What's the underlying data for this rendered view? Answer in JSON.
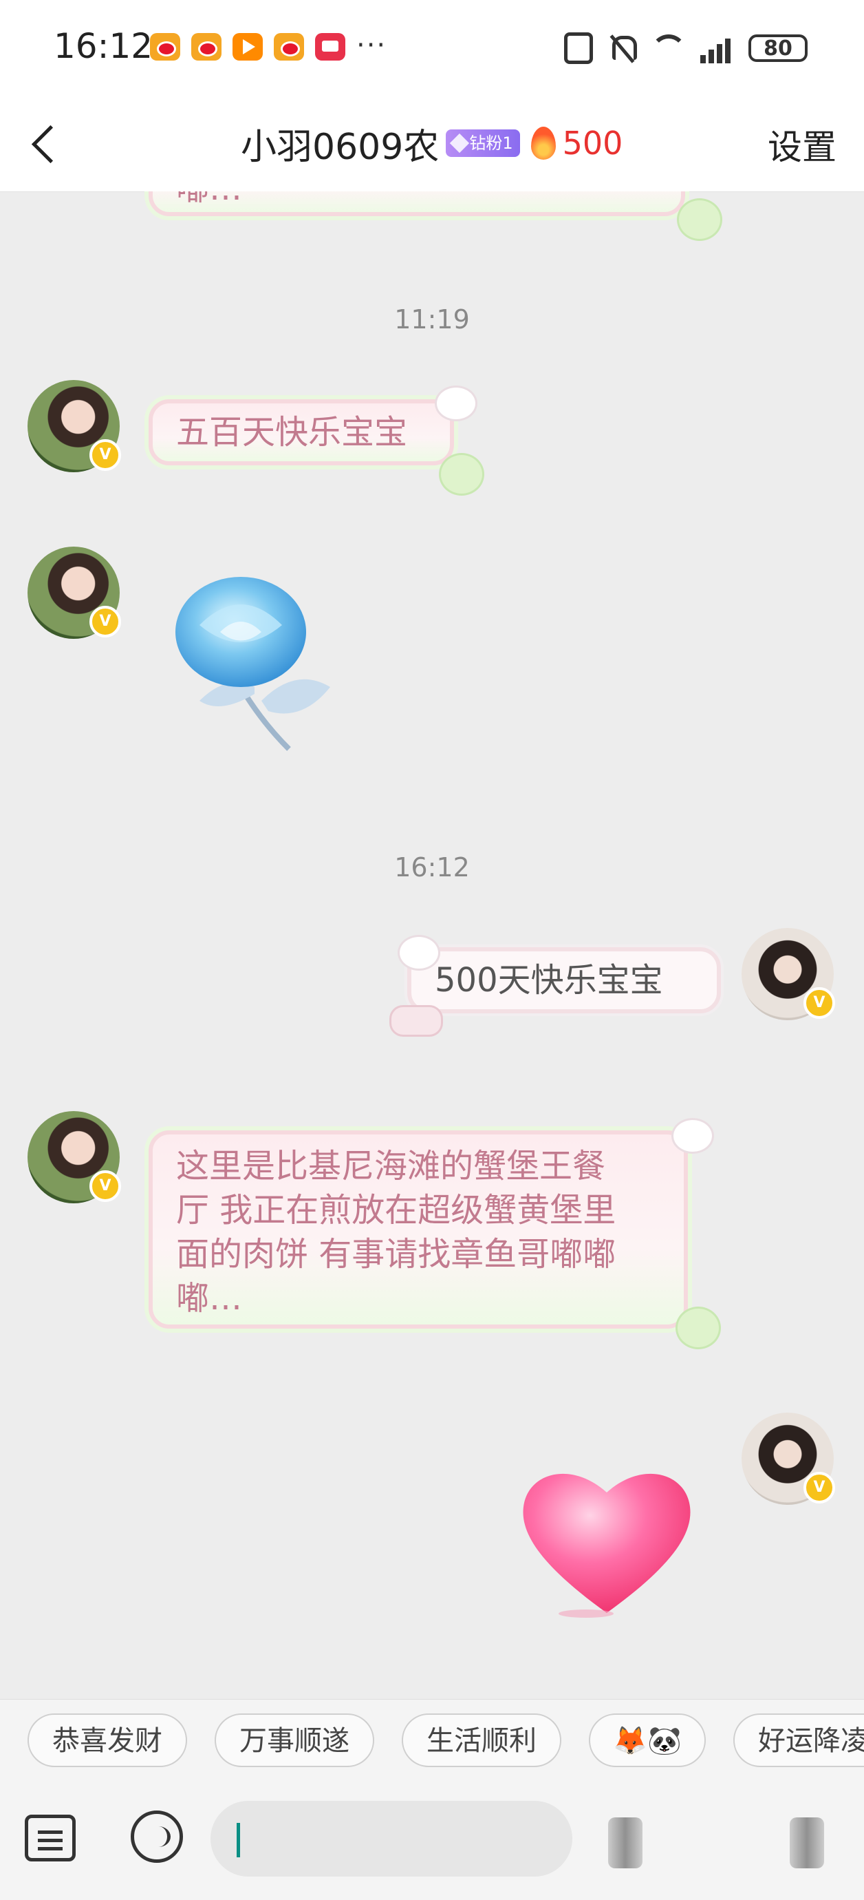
{
  "status_bar": {
    "time": "16:12",
    "more_indicator": "···",
    "battery": "80",
    "notification_icons": [
      "weibo-icon",
      "weibo-icon",
      "video-app-icon",
      "weibo-icon",
      "red-app-icon"
    ],
    "system_icons": [
      "nfc-icon",
      "mute-icon",
      "wifi-icon",
      "signal-icon",
      "battery-icon"
    ]
  },
  "header": {
    "title": "小羽0609农",
    "fan_badge": "钻粉1",
    "streak_count": "500",
    "settings_label": "设置"
  },
  "chat": {
    "partial_top_text": "嘟…",
    "timestamps": [
      "11:19",
      "16:12"
    ],
    "messages": [
      {
        "sender": "other",
        "type": "text",
        "text": "五百天快乐宝宝"
      },
      {
        "sender": "other",
        "type": "sticker",
        "sticker": "blue-rose-icon"
      },
      {
        "sender": "me",
        "type": "text",
        "text": "500天快乐宝宝"
      },
      {
        "sender": "other",
        "type": "text",
        "text": "这里是比基尼海滩的蟹堡王餐厅 我正在煎放在超级蟹黄堡里面的肉饼 有事请找章鱼哥嘟嘟嘟…",
        "lines": [
          "这里是比基尼海滩的蟹堡王餐",
          "厅 我正在煎放在超级蟹黄堡里",
          "面的肉饼 有事请找章鱼哥嘟嘟",
          "嘟…"
        ]
      },
      {
        "sender": "me",
        "type": "sticker",
        "sticker": "pink-heart-icon"
      }
    ],
    "verified_badge": "V"
  },
  "quick_replies": [
    "恭喜发财",
    "万事顺遂",
    "生活顺利",
    "🦊🐼",
    "好运降凌"
  ],
  "input": {
    "value": "",
    "placeholder": ""
  },
  "colors": {
    "streak": "#e8312f",
    "bubble_text": "#c27a8e",
    "cursor": "#0a8f85",
    "badge": "#8a6cf0"
  }
}
